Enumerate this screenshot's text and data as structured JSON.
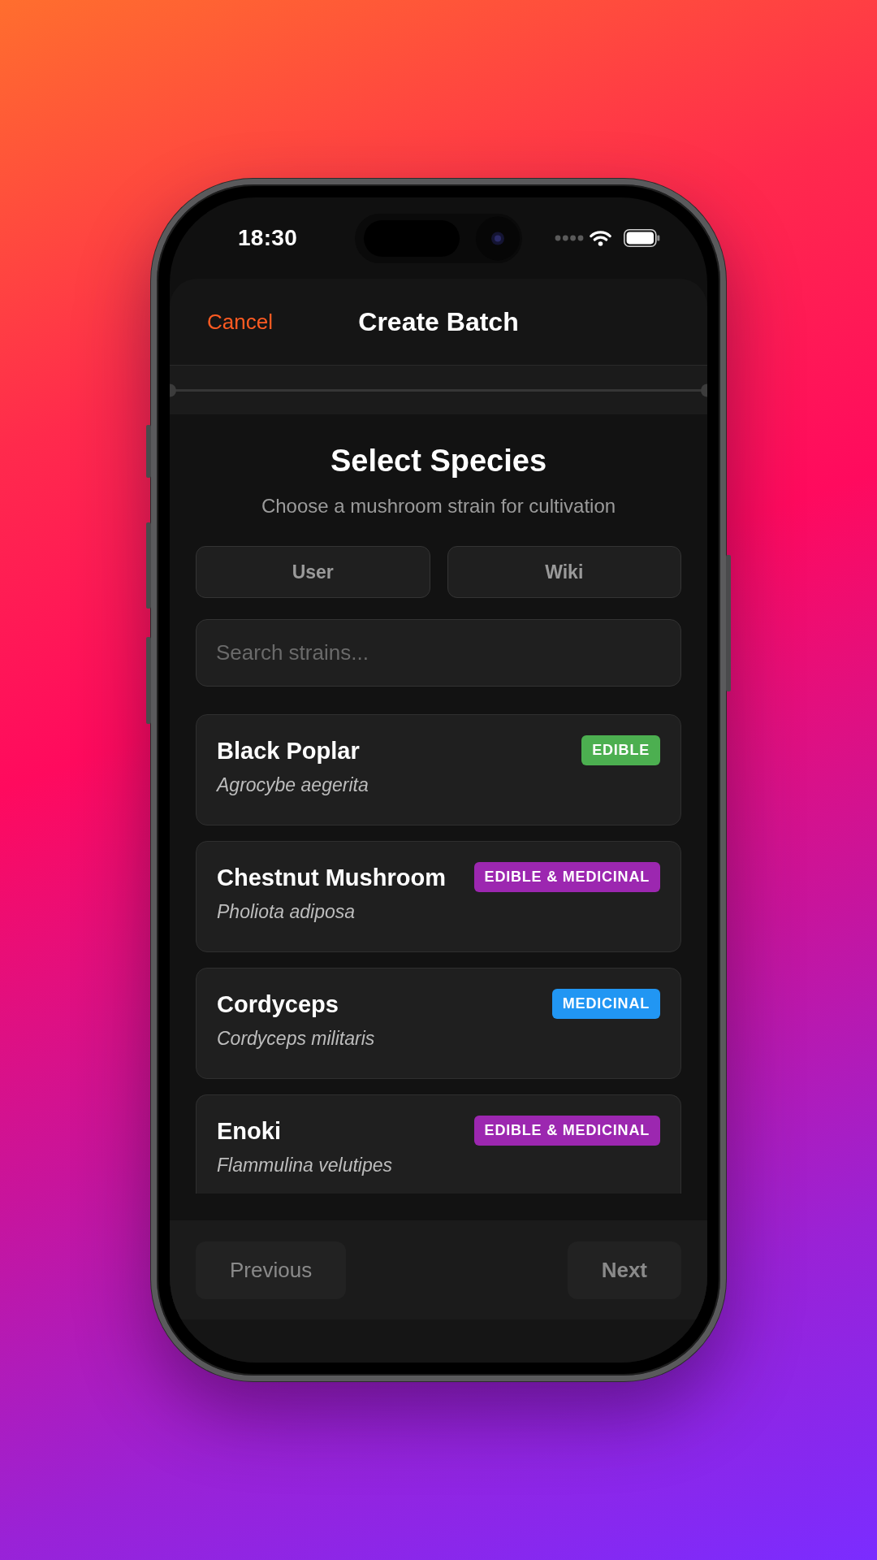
{
  "status_bar": {
    "time": "18:30"
  },
  "header": {
    "cancel": "Cancel",
    "title": "Create Batch"
  },
  "intro": {
    "title": "Select Species",
    "subtitle": "Choose a mushroom strain for cultivation"
  },
  "source_tabs": [
    {
      "label": "User",
      "selected": false
    },
    {
      "label": "Wiki",
      "selected": false
    }
  ],
  "search": {
    "placeholder": "Search strains..."
  },
  "species": [
    {
      "name": "Black Poplar",
      "scientific_name": "Agrocybe aegerita",
      "badge": {
        "label": "EDIBLE",
        "color": "#4caf50"
      }
    },
    {
      "name": "Chestnut Mushroom",
      "scientific_name": "Pholiota adiposa",
      "badge": {
        "label": "EDIBLE & MEDICINAL",
        "color": "#9c27b0"
      }
    },
    {
      "name": "Cordyceps",
      "scientific_name": "Cordyceps militaris",
      "badge": {
        "label": "MEDICINAL",
        "color": "#2196f3"
      }
    },
    {
      "name": "Enoki",
      "scientific_name": "Flammulina velutipes",
      "badge": {
        "label": "EDIBLE & MEDICINAL",
        "color": "#9c27b0"
      }
    }
  ],
  "footer": {
    "buttons": [
      {
        "label": "Previous",
        "kind": "secondary",
        "disabled": true
      },
      {
        "label": "Next",
        "kind": "primary",
        "disabled": true
      }
    ]
  }
}
